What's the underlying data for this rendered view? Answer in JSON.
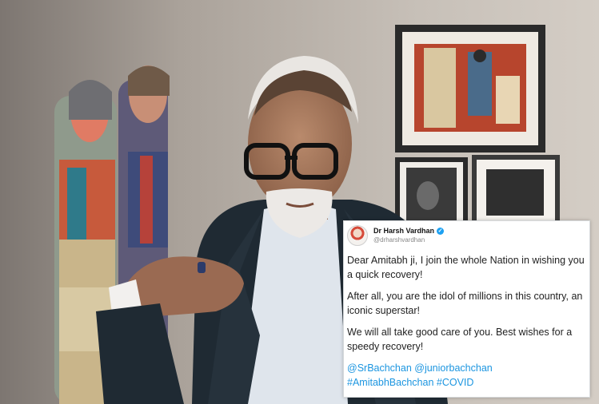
{
  "tweet": {
    "author_name": "Dr Harsh Vardhan",
    "author_handle": "@drharshvardhan",
    "paragraph1": "Dear Amitabh ji, I join the whole Nation in wishing you a quick recovery!",
    "paragraph2": "After all, you are the idol of millions in this country, an iconic superstar!",
    "paragraph3": "We will all take good care of you. Best wishes for a speedy recovery!",
    "mentions": "@SrBachchan @juniorbachchan",
    "hashtags": "#AmitabhBachchan #COVID"
  },
  "colors": {
    "link": "#1b95e0",
    "verified_badge": "#1da1f2",
    "suit": "#1f2a33",
    "shirt": "#dfe5ec"
  },
  "icons": [
    "verified-badge-icon",
    "avatar"
  ]
}
